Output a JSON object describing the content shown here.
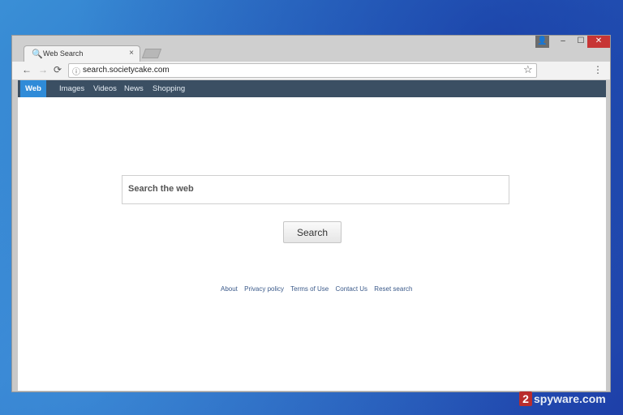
{
  "browser": {
    "tab_title": "Web Search",
    "tab_close": "×",
    "url": "search.societycake.com",
    "controls": {
      "user": "👤",
      "minimize": "–",
      "maximize": "☐",
      "close": "✕"
    },
    "nav": {
      "back": "←",
      "forward": "→",
      "reload": "⟳"
    },
    "icons": {
      "search": "search-icon",
      "info": "info-icon",
      "star": "star-icon",
      "menu": "menu-icon"
    }
  },
  "site_nav": {
    "items": [
      {
        "label": "Web",
        "active": true
      },
      {
        "label": "Images"
      },
      {
        "label": "Videos"
      },
      {
        "label": "News"
      },
      {
        "label": "Shopping"
      }
    ]
  },
  "search": {
    "placeholder": "Search the web",
    "button_label": "Search"
  },
  "footer": {
    "links": [
      "About",
      "Privacy policy",
      "Terms of Use",
      "Contact Us",
      "Reset search"
    ]
  },
  "watermark": {
    "badge": "2",
    "text": "spyware.com"
  },
  "colors": {
    "nav_bg": "#3b4f63",
    "nav_active": "#2f8bd8",
    "close_btn": "#c73535"
  }
}
